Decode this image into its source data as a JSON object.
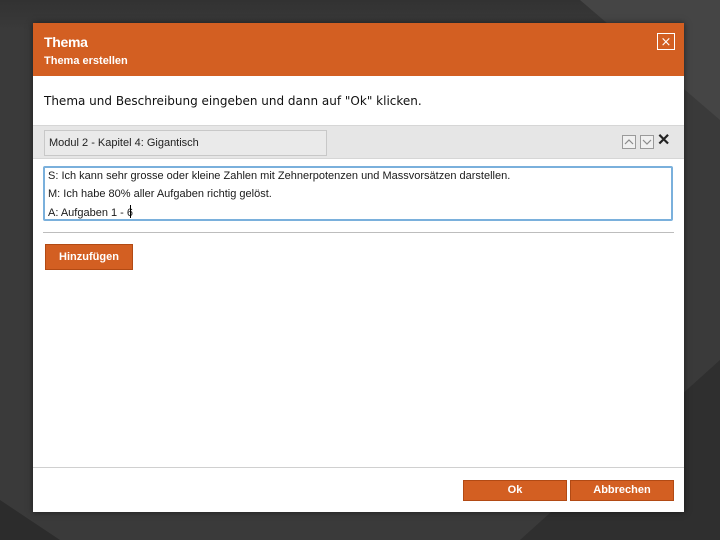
{
  "dialog": {
    "title": "Thema",
    "subtitle": "Thema erstellen",
    "close_symbol": "⨯",
    "instruction": "Thema und Beschreibung eingeben und dann auf \"Ok\" klicken."
  },
  "topic": {
    "name_value": "Modul 2 - Kapitel 4: Gigantisch",
    "up_icon": "chevron-up-icon",
    "down_icon": "chevron-down-icon",
    "remove_symbol": "✕",
    "description_lines": [
      "S: Ich kann sehr grosse oder kleine Zahlen mit Zehnerpotenzen und Massvorsätzen darstellen.",
      "M: Ich habe 80% aller Aufgaben richtig gelöst.",
      "A: Aufgaben 1 - 6"
    ]
  },
  "actions": {
    "add_label": "Hinzufügen",
    "ok_label": "Ok",
    "cancel_label": "Abbrechen"
  },
  "colors": {
    "accent": "#d35f22",
    "focus_border": "#7ab0dc",
    "backdrop": "#3a3a3a"
  }
}
